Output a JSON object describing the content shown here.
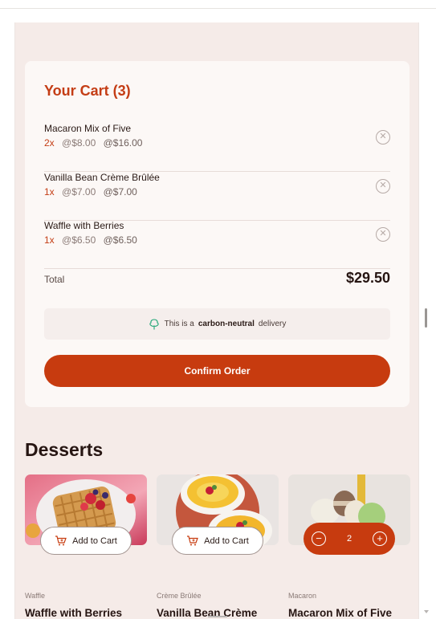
{
  "cart": {
    "title": "Your Cart (3)",
    "items": [
      {
        "name": "Macaron Mix of Five",
        "qty": "2x",
        "unit_price": "@$8.00",
        "line_total": "@$16.00"
      },
      {
        "name": "Vanilla Bean Crème Brûlée",
        "qty": "1x",
        "unit_price": "@$7.00",
        "line_total": "@$7.00"
      },
      {
        "name": "Waffle with Berries",
        "qty": "1x",
        "unit_price": "@$6.50",
        "line_total": "@$6.50"
      }
    ],
    "total_label": "Total",
    "total_value": "$29.50",
    "carbon": {
      "prefix": "This is a",
      "highlight": "carbon-neutral",
      "suffix": "delivery",
      "icon": "tree-icon"
    },
    "confirm_label": "Confirm Order"
  },
  "desserts": {
    "title": "Desserts",
    "products": [
      {
        "category": "Waffle",
        "name": "Waffle with Berries",
        "button": "Add to Cart"
      },
      {
        "category": "Crème Brûlée",
        "name": "Vanilla Bean Crème Brûlée",
        "button": "Add to Cart"
      },
      {
        "category": "Macaron",
        "name": "Macaron Mix of Five",
        "stepper_value": "2"
      }
    ]
  },
  "colors": {
    "accent": "#c73b0f",
    "background": "#f5ebe8",
    "card": "#fcf8f6",
    "text": "#261512",
    "carbon_icon": "#1ea575"
  },
  "icons": [
    "remove-item-icon",
    "tree-icon",
    "add-to-cart-icon",
    "minus-icon",
    "plus-icon"
  ]
}
